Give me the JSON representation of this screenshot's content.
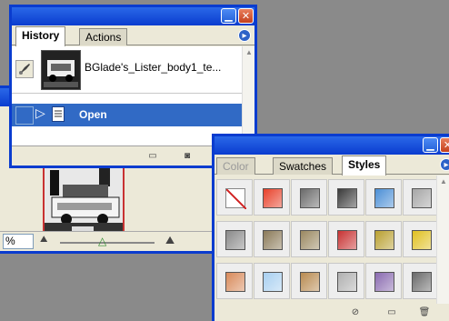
{
  "navigator": {
    "zoom_value": "%"
  },
  "history": {
    "tabs": [
      {
        "label": "History",
        "active": true
      },
      {
        "label": "Actions",
        "active": false
      }
    ],
    "snapshot_label": "BGlade's_Lister_body1_te...",
    "steps": [
      {
        "label": "Open",
        "selected": true
      }
    ]
  },
  "styles": {
    "tabs": [
      {
        "label": "Color",
        "active": false
      },
      {
        "label": "Swatches",
        "active": false
      },
      {
        "label": "Styles",
        "active": true
      }
    ],
    "swatches": [
      [
        "none",
        "#e8412a",
        "#6a6a6a",
        "#3a3a3a",
        "#4b8fd6",
        "#a6a6a6"
      ],
      [
        "#8a8a8a",
        "#8b7a58",
        "#9a8860",
        "#c83232",
        "#b9a030",
        "#e0c020"
      ],
      [
        "#d88a5a",
        "#a8cff0",
        "#b88a50",
        "#b0b0b0",
        "#8a6ab0",
        "#6a6a6a"
      ]
    ]
  },
  "colors": {
    "titlebar": "#0a3ccf",
    "selection": "#316ac5",
    "panel": "#ece9d8"
  }
}
